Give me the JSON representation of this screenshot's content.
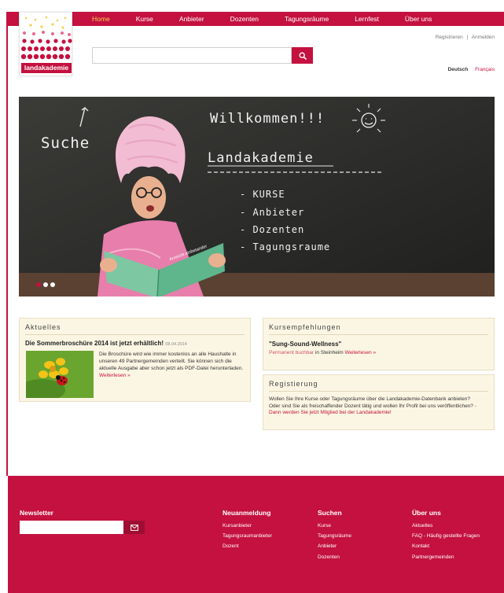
{
  "nav": {
    "items": [
      {
        "label": "Home",
        "active": true
      },
      {
        "label": "Kurse"
      },
      {
        "label": "Anbieter"
      },
      {
        "label": "Dozenten"
      },
      {
        "label": "Tagungsräume"
      },
      {
        "label": "Lernfest"
      },
      {
        "label": "Über uns"
      }
    ]
  },
  "logo": {
    "text": "landakademie"
  },
  "search": {
    "placeholder": "",
    "button_icon": "search-icon"
  },
  "account": {
    "register": "Registrieren",
    "separator": "|",
    "login": "Anmelden"
  },
  "language": {
    "de": "Deutsch",
    "fr": "Français"
  },
  "hero": {
    "left_text": "Suche",
    "title": "Willkommen!!!",
    "subtitle": "Landakademie",
    "list": [
      "- KURSE",
      "- Anbieter",
      "- Dozenten",
      "- Tagungsraume"
    ],
    "book_text": "Anreicht einbetander",
    "slides": 3,
    "active_slide": 0
  },
  "aktuelles": {
    "title": "Aktuelles",
    "headline": "Die Sommerbroschüre 2014 ist jetzt erhältlich!",
    "date": "08.04.2014",
    "body": "Die Broschüre wird wie immer kostenlos an alle Haushalte in unseren 49 Partnergemeinden verteilt. Sie können sich die aktuelle Ausgabe aber schon jetzt als PDF-Datei herunterladen.",
    "more": "Weiterlesen »"
  },
  "kursempfehlungen": {
    "title": "Kursempfehlungen",
    "name": "\"Sung-Sound-Wellness\"",
    "sub_muted": "Permanent buchbar",
    "sub_in": "in Steinheim",
    "more": "Weiterlesen »"
  },
  "registrierung": {
    "title": "Registierung",
    "line1": "Wollen Sie Ihre Kurse oder Tagungsräume über die Landakademie-Datenbank anbieten?",
    "line2": "Oder sind Sie als freischaffender Dozent tätig und wollen Ihr Profil bei uns veröffentlichen?",
    "link": "- Dann werden Sie jetzt Mitglied bei der Landakademie!"
  },
  "footer": {
    "newsletter": "Newsletter",
    "neuanmeldung": {
      "title": "Neuanmeldung",
      "links": [
        "Kursanbieter",
        "Tagungsraumanbieter",
        "Dozent"
      ]
    },
    "suchen": {
      "title": "Suchen",
      "links": [
        "Kurse",
        "Tagungsräume",
        "Anbieter",
        "Dozenten"
      ]
    },
    "ueberuns": {
      "title": "Über uns",
      "links": [
        "Aktuelles",
        "FAQ - Häufig gestellte Fragen",
        "Kontakt",
        "Partnergemeinden"
      ]
    }
  },
  "colors": {
    "brand": "#c4113f",
    "nav_active": "#f6d04d",
    "box_bg": "#fbf6e4"
  }
}
